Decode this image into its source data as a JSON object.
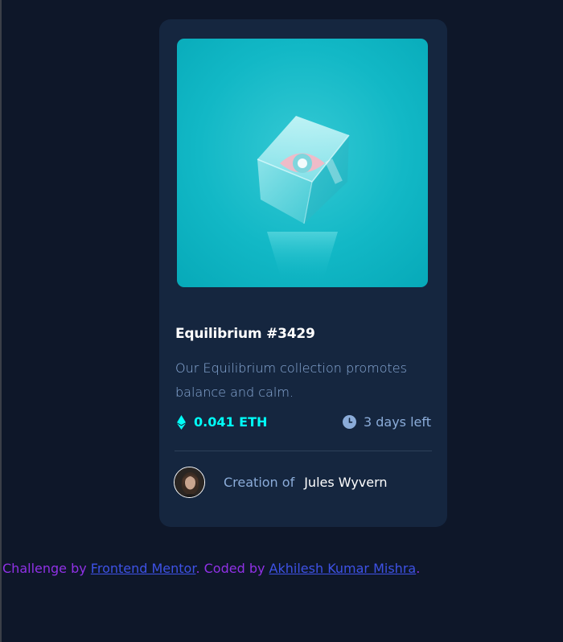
{
  "card": {
    "image_alt": "Equilibrium NFT cube with eye",
    "title": "Equilibrium #3429",
    "description": "Our Equilibrium collection promotes balance and calm.",
    "price": "0.041 ETH",
    "time_left": "3 days left",
    "creator_prefix": "Creation of",
    "creator_name": "Jules Wyvern"
  },
  "attribution": {
    "prefix": "Challenge by ",
    "link1": "Frontend Mentor",
    "middle": ". Coded by ",
    "link2": "Akhilesh Kumar Mishra",
    "suffix": "."
  },
  "colors": {
    "page_bg": "#0e1729",
    "card_bg": "#15263f",
    "accent_cyan": "#00fff8",
    "soft_blue": "#8bacd9",
    "white": "#ffffff",
    "attribution_purple": "#9031e6",
    "link_blue": "#3e52e6"
  },
  "icons": [
    "ethereum-icon",
    "clock-icon"
  ]
}
